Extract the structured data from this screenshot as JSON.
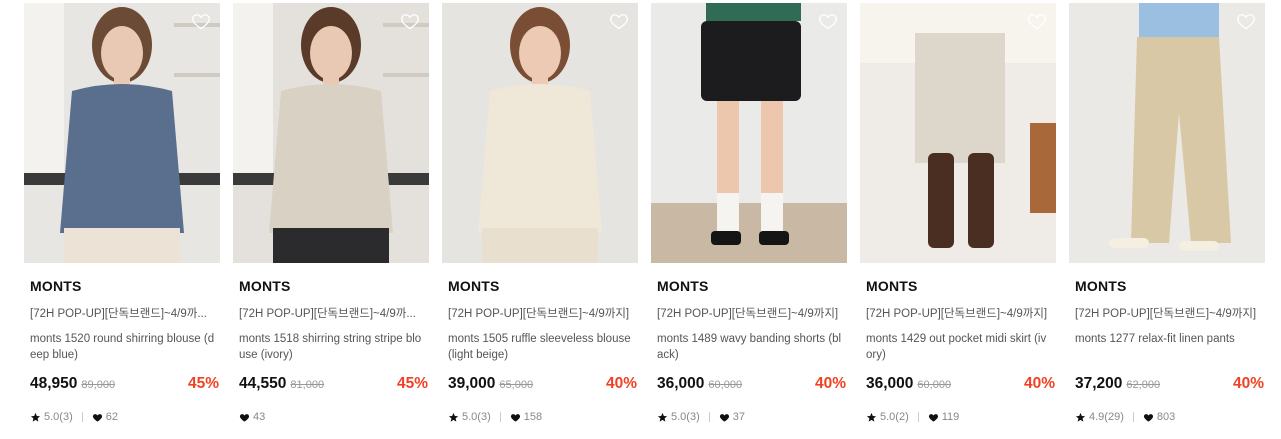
{
  "colors": {
    "discount": "#f04123",
    "text": "#111111",
    "muted": "#888888"
  },
  "products": [
    {
      "brand": "MONTS",
      "promo": "[72H POP-UP][단독브랜드]~4/9까...",
      "name": "monts 1520 round shirring blouse (deep blue)",
      "price": "48,950",
      "original": "89,000",
      "discount": "45%",
      "rating": "5.0(3)",
      "likes": "62",
      "has_rating": true,
      "image": {
        "bg": "#e8e6e2",
        "garment": "#5a6e8e",
        "bottom": "#ece3d6",
        "skin": "#e9c9b3",
        "hair": "#6b4a36"
      }
    },
    {
      "brand": "MONTS",
      "promo": "[72H POP-UP][단독브랜드]~4/9까...",
      "name": "monts 1518 shirring string stripe blouse (ivory)",
      "price": "44,550",
      "original": "81,000",
      "discount": "45%",
      "rating": "",
      "likes": "43",
      "has_rating": false,
      "image": {
        "bg": "#e4e1dc",
        "garment": "#d9d1c4",
        "bottom": "#2b2b2e",
        "skin": "#e9c9b3",
        "hair": "#5a3b2a"
      }
    },
    {
      "brand": "MONTS",
      "promo": "[72H POP-UP][단독브랜드]~4/9까지]",
      "name": "monts 1505 ruffle sleeveless blouse (light beige)",
      "price": "39,000",
      "original": "65,000",
      "discount": "40%",
      "rating": "5.0(3)",
      "likes": "158",
      "has_rating": true,
      "image": {
        "bg": "#e6e4e1",
        "garment": "#efe7d8",
        "bottom": "#e8dfcf",
        "skin": "#eccab3",
        "hair": "#7a4e34"
      }
    },
    {
      "brand": "MONTS",
      "promo": "[72H POP-UP][단독브랜드]~4/9까지]",
      "name": "monts 1489 wavy banding shorts (black)",
      "price": "36,000",
      "original": "60,000",
      "discount": "40%",
      "rating": "5.0(3)",
      "likes": "37",
      "has_rating": true,
      "image": {
        "bg": "#eaeae8",
        "garment": "#1c1c1f",
        "bottom": "#c9b8a4",
        "skin": "#ecc7ae",
        "hair": "#2f6b55"
      }
    },
    {
      "brand": "MONTS",
      "promo": "[72H POP-UP][단독브랜드]~4/9까지]",
      "name": "monts 1429 out pocket midi skirt (ivory)",
      "price": "36,000",
      "original": "60,000",
      "discount": "40%",
      "rating": "5.0(2)",
      "likes": "119",
      "has_rating": true,
      "image": {
        "bg": "#efece8",
        "garment": "#dcd6cb",
        "bottom": "#4a2e22",
        "skin": "#ecc7ae",
        "hair": "#f2eee6"
      }
    },
    {
      "brand": "MONTS",
      "promo": "[72H POP-UP][단독브랜드]~4/9까지]",
      "name": "monts 1277 relax-fit linen pants",
      "price": "37,200",
      "original": "62,000",
      "discount": "40%",
      "rating": "4.9(29)",
      "likes": "803",
      "has_rating": true,
      "image": {
        "bg": "#ebe9e6",
        "garment": "#d9c8a6",
        "bottom": "#e9d8bf",
        "skin": "#ecc7ae",
        "hair": "#9bbfe0"
      }
    }
  ]
}
